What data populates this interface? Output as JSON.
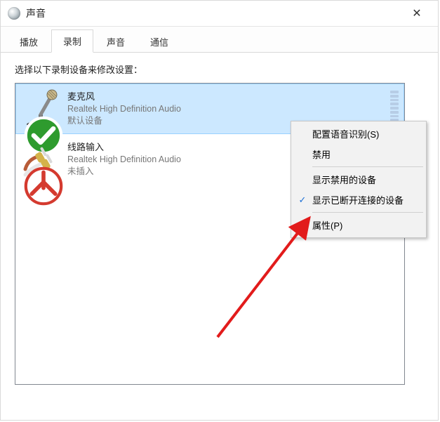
{
  "window": {
    "title": "声音",
    "close_label": "✕"
  },
  "tabs": [
    {
      "label": "播放",
      "active": false
    },
    {
      "label": "录制",
      "active": true
    },
    {
      "label": "声音",
      "active": false
    },
    {
      "label": "通信",
      "active": false
    }
  ],
  "instruction": "选择以下录制设备来修改设置：",
  "devices": [
    {
      "name": "麦克风",
      "driver": "Realtek High Definition Audio",
      "status": "默认设备",
      "status_kind": "default",
      "selected": true,
      "icon": "microphone-icon",
      "show_level_meter": true
    },
    {
      "name": "线路输入",
      "driver": "Realtek High Definition Audio",
      "status": "未插入",
      "status_kind": "unplugged",
      "selected": false,
      "icon": "line-in-icon",
      "show_level_meter": false
    }
  ],
  "context_menu": {
    "items": [
      {
        "label": "配置语音识别(S)",
        "checked": false
      },
      {
        "label": "禁用",
        "checked": false
      },
      {
        "separator": true
      },
      {
        "label": "显示禁用的设备",
        "checked": false
      },
      {
        "label": "显示已断开连接的设备",
        "checked": true
      },
      {
        "separator": true
      },
      {
        "label": "属性(P)",
        "checked": false
      }
    ]
  }
}
